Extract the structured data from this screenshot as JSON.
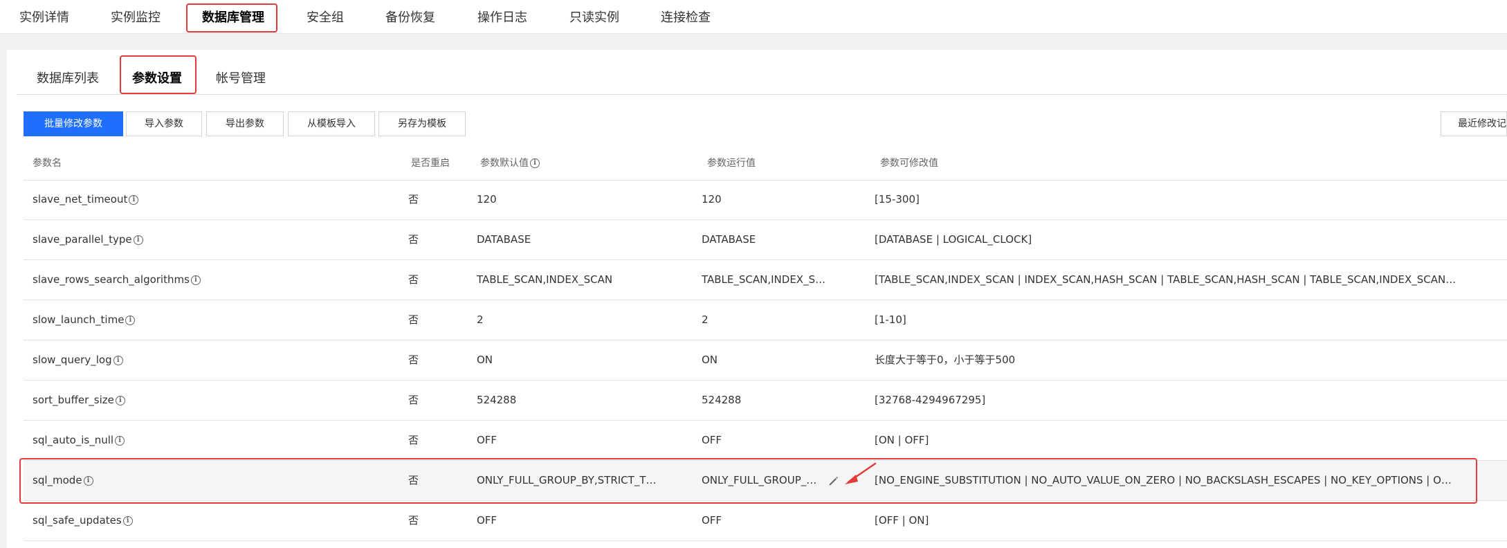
{
  "top_tabs": [
    {
      "label": "实例详情"
    },
    {
      "label": "实例监控"
    },
    {
      "label": "数据库管理"
    },
    {
      "label": "安全组"
    },
    {
      "label": "备份恢复"
    },
    {
      "label": "操作日志"
    },
    {
      "label": "只读实例"
    },
    {
      "label": "连接检查"
    }
  ],
  "sub_tabs": [
    {
      "label": "数据库列表"
    },
    {
      "label": "参数设置"
    },
    {
      "label": "帐号管理"
    }
  ],
  "toolbar": {
    "batch_modify": "批量修改参数",
    "import_params": "导入参数",
    "export_params": "导出参数",
    "import_from_template": "从模板导入",
    "save_as_template": "另存为模板",
    "recent_changes": "最近修改记录"
  },
  "table": {
    "headers": {
      "name": "参数名",
      "restart": "是否重启",
      "default": "参数默认值",
      "running": "参数运行值",
      "allowed": "参数可修改值"
    },
    "info_glyph": "i",
    "rows": [
      {
        "name": "slave_net_timeout",
        "restart": "否",
        "default": "120",
        "running": "120",
        "allowed": "[15-300]"
      },
      {
        "name": "slave_parallel_type",
        "restart": "否",
        "default": "DATABASE",
        "running": "DATABASE",
        "allowed": "[DATABASE | LOGICAL_CLOCK]"
      },
      {
        "name": "slave_rows_search_algorithms",
        "restart": "否",
        "default": "TABLE_SCAN,INDEX_SCAN",
        "running": "TABLE_SCAN,INDEX_S…",
        "allowed": "[TABLE_SCAN,INDEX_SCAN | INDEX_SCAN,HASH_SCAN | TABLE_SCAN,HASH_SCAN | TABLE_SCAN,INDEX_SCAN…"
      },
      {
        "name": "slow_launch_time",
        "restart": "否",
        "default": "2",
        "running": "2",
        "allowed": "[1-10]"
      },
      {
        "name": "slow_query_log",
        "restart": "否",
        "default": "ON",
        "running": "ON",
        "allowed": "长度大于等于0，小于等于500"
      },
      {
        "name": "sort_buffer_size",
        "restart": "否",
        "default": "524288",
        "running": "524288",
        "allowed": "[32768-4294967295]"
      },
      {
        "name": "sql_auto_is_null",
        "restart": "否",
        "default": "OFF",
        "running": "OFF",
        "allowed": "[ON | OFF]"
      },
      {
        "name": "sql_mode",
        "restart": "否",
        "default": "ONLY_FULL_GROUP_BY,STRICT_T…",
        "running": "ONLY_FULL_GROUP_…",
        "allowed": "[NO_ENGINE_SUBSTITUTION | NO_AUTO_VALUE_ON_ZERO | NO_BACKSLASH_ESCAPES | NO_KEY_OPTIONS | O…"
      },
      {
        "name": "sql_safe_updates",
        "restart": "否",
        "default": "OFF",
        "running": "OFF",
        "allowed": "[OFF | ON]"
      }
    ]
  },
  "colors": {
    "primary": "#1e6fff",
    "highlight_border": "#e33a3a"
  },
  "icons": {
    "info": "info-circle-icon",
    "edit": "pencil-icon",
    "annotation": "red-arrow-icon"
  }
}
